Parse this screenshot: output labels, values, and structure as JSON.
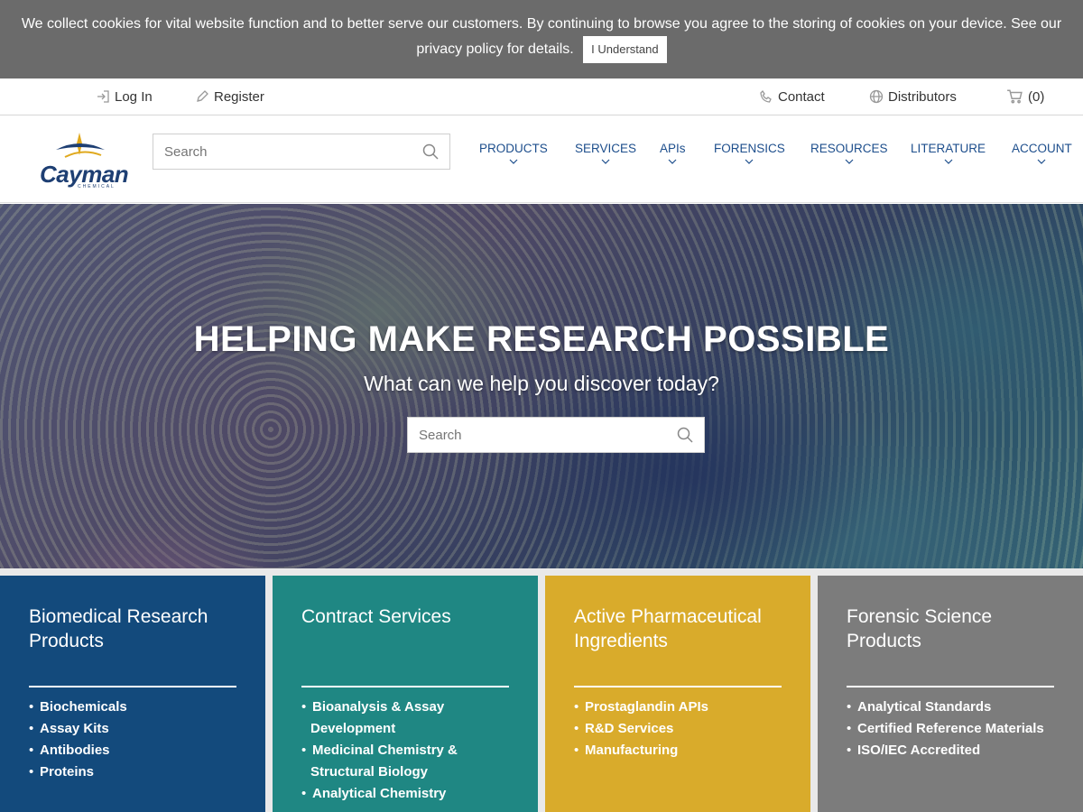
{
  "cookie": {
    "message": "We collect cookies for vital website function and to better serve our customers. By continuing to browse you agree to the storing of cookies on your device. See our privacy policy for details.",
    "button": "I Understand"
  },
  "utility": {
    "login": "Log In",
    "register": "Register",
    "contact": "Contact",
    "distributors": "Distributors",
    "cart": "(0)"
  },
  "header": {
    "logo_word": "Cayman",
    "logo_sub": "CHEMICAL",
    "search_placeholder": "Search",
    "nav": [
      "PRODUCTS",
      "SERVICES",
      "APIs",
      "FORENSICS",
      "RESOURCES",
      "LITERATURE",
      "ACCOUNT"
    ]
  },
  "hero": {
    "title": "HELPING MAKE RESEARCH POSSIBLE",
    "subtitle": "What can we help you discover today?",
    "search_placeholder": "Search"
  },
  "tiles": [
    {
      "title": "Biomedical Research Products",
      "color": "#134a7c",
      "items": [
        "Biochemicals",
        "Assay Kits",
        "Antibodies",
        "Proteins"
      ]
    },
    {
      "title": "Contract Services",
      "color": "#1f8783",
      "items": [
        "Bioanalysis & Assay Development",
        "Medicinal Chemistry & Structural Biology",
        "Analytical Chemistry"
      ]
    },
    {
      "title": "Active Pharmaceutical Ingredients",
      "color": "#d9ab2b",
      "items": [
        "Prostaglandin APIs",
        "R&D Services",
        "Manufacturing"
      ]
    },
    {
      "title": "Forensic Science Products",
      "color": "#7c7c7c",
      "items": [
        "Analytical Standards",
        "Certified Reference Materials",
        "ISO/IEC Accredited"
      ]
    }
  ]
}
